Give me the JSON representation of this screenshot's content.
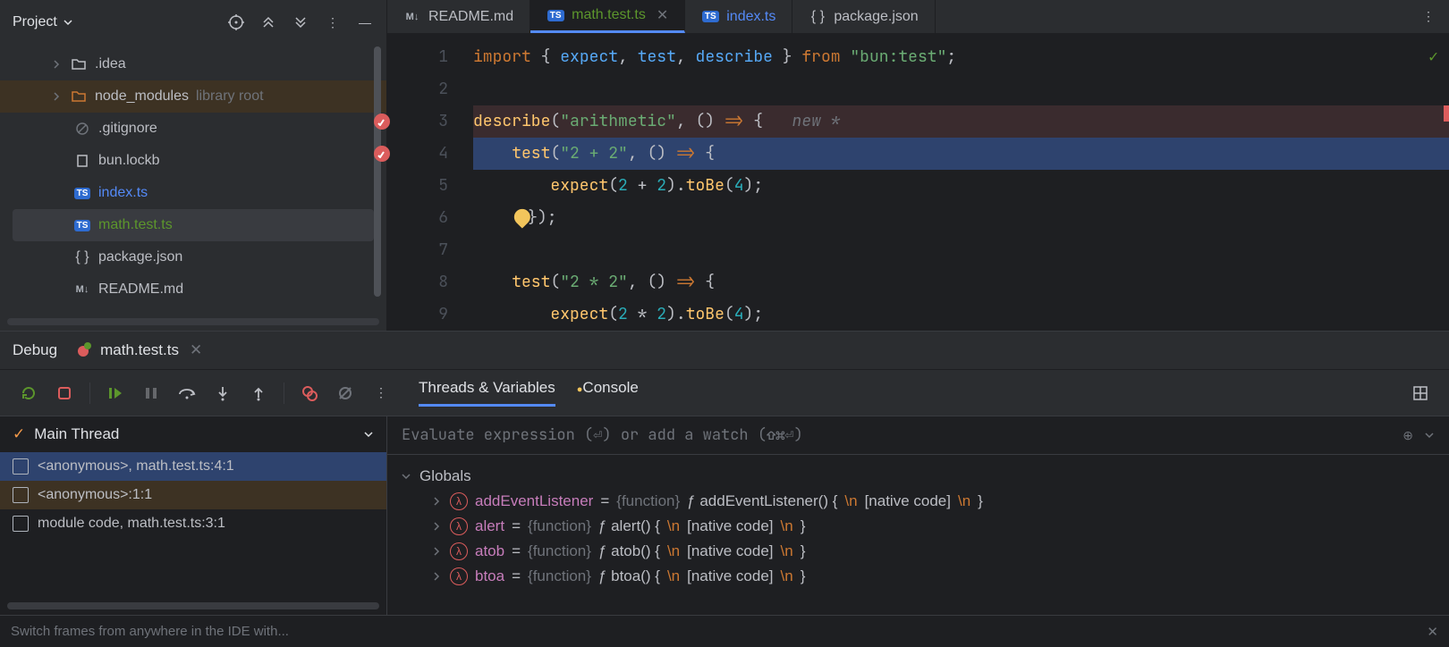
{
  "sidebar": {
    "title": "Project",
    "tree": [
      {
        "kind": "folder",
        "name": ".idea",
        "icon": "folder",
        "chevron": true
      },
      {
        "kind": "folder",
        "name": "node_modules",
        "suffix": "library root",
        "icon": "folder-orange",
        "chevron": true,
        "highlight": true
      },
      {
        "kind": "file",
        "name": ".gitignore",
        "icon": "gitignore"
      },
      {
        "kind": "file",
        "name": "bun.lockb",
        "icon": "file"
      },
      {
        "kind": "file",
        "name": "index.ts",
        "icon": "ts",
        "color": "blue"
      },
      {
        "kind": "file",
        "name": "math.test.ts",
        "icon": "ts-test",
        "color": "green",
        "selected": true
      },
      {
        "kind": "file",
        "name": "package.json",
        "icon": "json"
      },
      {
        "kind": "file",
        "name": "README.md",
        "icon": "md"
      }
    ]
  },
  "tabs": [
    {
      "label": "README.md",
      "icon": "md",
      "active": false
    },
    {
      "label": "math.test.ts",
      "icon": "ts-test",
      "active": true,
      "color": "green",
      "closeable": true
    },
    {
      "label": "index.ts",
      "icon": "ts",
      "active": false,
      "color": "blue"
    },
    {
      "label": "package.json",
      "icon": "json",
      "active": false
    }
  ],
  "editor": {
    "lines": [
      {
        "n": 1,
        "html": "<span class='kw'>import</span> <span class='pn'>{</span> <span class='fn'>expect</span><span class='pn'>,</span> <span class='fn'>test</span><span class='pn'>,</span> <span class='fn'>describe</span> <span class='pn'>}</span> <span class='kw'>from</span> <span class='str'>\"bun:test\"</span><span class='pn'>;</span>"
      },
      {
        "n": 2,
        "html": ""
      },
      {
        "n": 3,
        "html": "<span class='fn2'>describe</span><span class='pn'>(</span><span class='str'>\"arithmetic\"</span><span class='pn'>,</span> <span class='pn'>()</span> <span class='kw'>=></span> <span class='pn'>{</span>   <span class='hint'>new *</span>",
        "bp": true,
        "newline": true
      },
      {
        "n": 4,
        "html": "    <span class='fn2'>test</span><span class='pn'>(</span><span class='str'>\"2 + 2\"</span><span class='pn'>,</span> <span class='pn'>()</span> <span class='kw'>=></span> <span class='pn'>{</span>",
        "bp": true,
        "current": true
      },
      {
        "n": 5,
        "html": "        <span class='fn2'>expect</span><span class='pn'>(</span><span class='num'>2</span> <span class='pn'>+</span> <span class='num'>2</span><span class='pn'>).</span><span class='fn2'>toBe</span><span class='pn'>(</span><span class='num'>4</span><span class='pn'>);</span>"
      },
      {
        "n": 6,
        "html": "    <span class='bulb'></span><span class='pn'>});</span>"
      },
      {
        "n": 7,
        "html": ""
      },
      {
        "n": 8,
        "html": "    <span class='fn2'>test</span><span class='pn'>(</span><span class='str'>\"2 * 2\"</span><span class='pn'>,</span> <span class='pn'>()</span> <span class='kw'>=></span> <span class='pn'>{</span>"
      },
      {
        "n": 9,
        "html": "        <span class='fn2'>expect</span><span class='pn'>(</span><span class='num'>2</span> <span class='pn'>*</span> <span class='num'>2</span><span class='pn'>).</span><span class='fn2'>toBe</span><span class='pn'>(</span><span class='num'>4</span><span class='pn'>);</span>"
      }
    ]
  },
  "debug": {
    "label": "Debug",
    "tab": "math.test.ts",
    "subtabs": {
      "threads": "Threads & Variables",
      "console": "Console"
    },
    "thread_title": "Main Thread",
    "frames": [
      {
        "label": "<anonymous>, math.test.ts:4:1",
        "sel": true
      },
      {
        "label": "<anonymous>:1:1",
        "alt": true
      },
      {
        "label": "module code, math.test.ts:3:1"
      }
    ],
    "watch_placeholder": "Evaluate expression (⏎) or add a watch (⇧⌘⏎)",
    "globals_label": "Globals",
    "vars": [
      {
        "name": "addEventListener",
        "body": "ƒ addEventListener() {\\n    [native code]\\n}"
      },
      {
        "name": "alert",
        "body": "ƒ alert() {\\n    [native code]\\n}"
      },
      {
        "name": "atob",
        "body": "ƒ atob() {\\n    [native code]\\n}"
      },
      {
        "name": "btoa",
        "body": "ƒ btoa() {\\n    [native code]\\n}"
      }
    ]
  },
  "status": "Switch frames from anywhere in the IDE with..."
}
